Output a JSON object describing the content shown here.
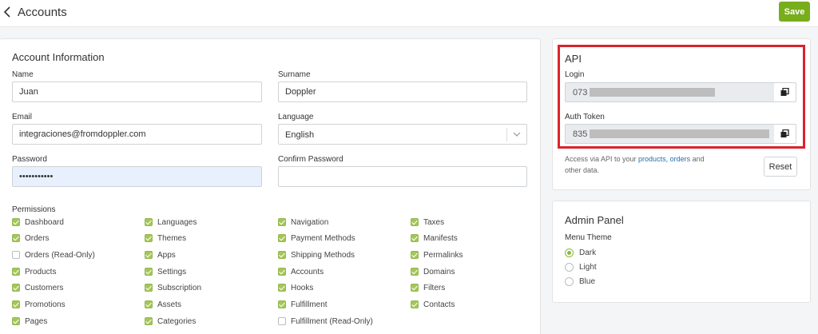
{
  "header": {
    "title": "Accounts",
    "save_label": "Save"
  },
  "account": {
    "title": "Account Information",
    "name_label": "Name",
    "name_value": "Juan",
    "surname_label": "Surname",
    "surname_value": "Doppler",
    "email_label": "Email",
    "email_value": "integraciones@fromdoppler.com",
    "language_label": "Language",
    "language_value": "English",
    "password_label": "Password",
    "password_value": "•••••••••••",
    "confirm_label": "Confirm Password",
    "confirm_value": "",
    "permissions_label": "Permissions",
    "permissions": [
      [
        {
          "label": "Dashboard",
          "checked": true
        },
        {
          "label": "Orders",
          "checked": true
        },
        {
          "label": "Orders (Read-Only)",
          "checked": false
        },
        {
          "label": "Products",
          "checked": true
        },
        {
          "label": "Customers",
          "checked": true
        },
        {
          "label": "Promotions",
          "checked": true
        },
        {
          "label": "Pages",
          "checked": true
        }
      ],
      [
        {
          "label": "Languages",
          "checked": true
        },
        {
          "label": "Themes",
          "checked": true
        },
        {
          "label": "Apps",
          "checked": true
        },
        {
          "label": "Settings",
          "checked": true
        },
        {
          "label": "Subscription",
          "checked": true
        },
        {
          "label": "Assets",
          "checked": true
        },
        {
          "label": "Categories",
          "checked": true
        }
      ],
      [
        {
          "label": "Navigation",
          "checked": true
        },
        {
          "label": "Payment Methods",
          "checked": true
        },
        {
          "label": "Shipping Methods",
          "checked": true
        },
        {
          "label": "Accounts",
          "checked": true
        },
        {
          "label": "Hooks",
          "checked": true
        },
        {
          "label": "Fulfillment",
          "checked": true
        },
        {
          "label": "Fulfillment (Read-Only)",
          "checked": false
        }
      ],
      [
        {
          "label": "Taxes",
          "checked": true
        },
        {
          "label": "Manifests",
          "checked": true
        },
        {
          "label": "Permalinks",
          "checked": true
        },
        {
          "label": "Domains",
          "checked": true
        },
        {
          "label": "Filters",
          "checked": true
        },
        {
          "label": "Contacts",
          "checked": true
        }
      ]
    ]
  },
  "api": {
    "title": "API",
    "login_label": "Login",
    "login_prefix": "073",
    "token_label": "Auth Token",
    "token_prefix": "835",
    "note_prefix": "Access via API to your ",
    "note_link1": "products",
    "note_sep": ", ",
    "note_link2": "orders",
    "note_suffix": " and other data.",
    "reset_label": "Reset"
  },
  "admin": {
    "title": "Admin Panel",
    "menu_theme_label": "Menu Theme",
    "themes": [
      {
        "label": "Dark",
        "selected": true
      },
      {
        "label": "Light",
        "selected": false
      },
      {
        "label": "Blue",
        "selected": false
      }
    ]
  },
  "colors": {
    "accent": "#78ad1c",
    "highlight": "#d9232e",
    "link": "#1f6fb3"
  }
}
